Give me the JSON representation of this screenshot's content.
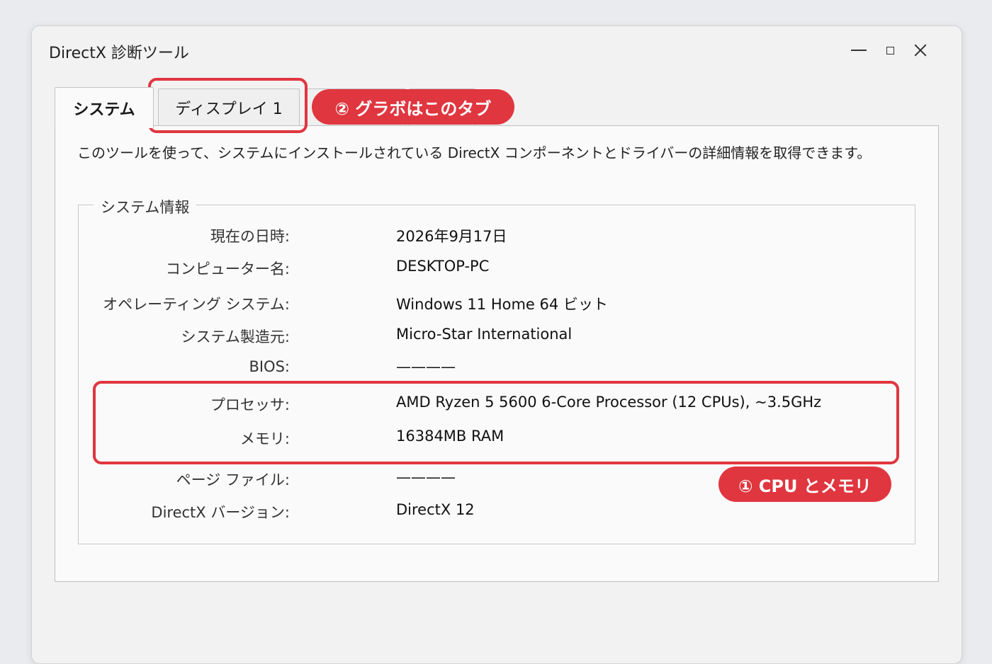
{
  "window": {
    "title": "DirectX 診断ツール"
  },
  "tabs": [
    {
      "label": "システム"
    },
    {
      "label": "ディスプレイ 1"
    },
    {
      "label": ""
    },
    {
      "label": ""
    }
  ],
  "intro": "このツールを使って、システムにインストールされている DirectX コンポーネントとドライバーの詳細情報を取得できます。",
  "system_info": {
    "legend": "システム情報",
    "rows": [
      {
        "label": "現在の日時:",
        "value": "2026年9月17日"
      },
      {
        "label": "コンピューター名:",
        "value": "DESKTOP-PC"
      },
      {
        "label": "オペレーティング システム:",
        "value": "Windows 11 Home 64 ビット"
      },
      {
        "label": "システム製造元:",
        "value": "Micro-Star International"
      },
      {
        "label": "BIOS:",
        "value": "————"
      },
      {
        "label": "プロセッサ:",
        "value": "AMD Ryzen 5 5600 6-Core Processor (12 CPUs), ~3.5GHz"
      },
      {
        "label": "メモリ:",
        "value": "16384MB RAM"
      },
      {
        "label": "ページ ファイル:",
        "value": "————"
      },
      {
        "label": "DirectX バージョン:",
        "value": "DirectX 12"
      }
    ]
  },
  "annotations": {
    "gpu_tab": "② グラボはこのタブ",
    "cpu_memory": "① CPU とメモリ",
    "accent": "#e0363f"
  }
}
